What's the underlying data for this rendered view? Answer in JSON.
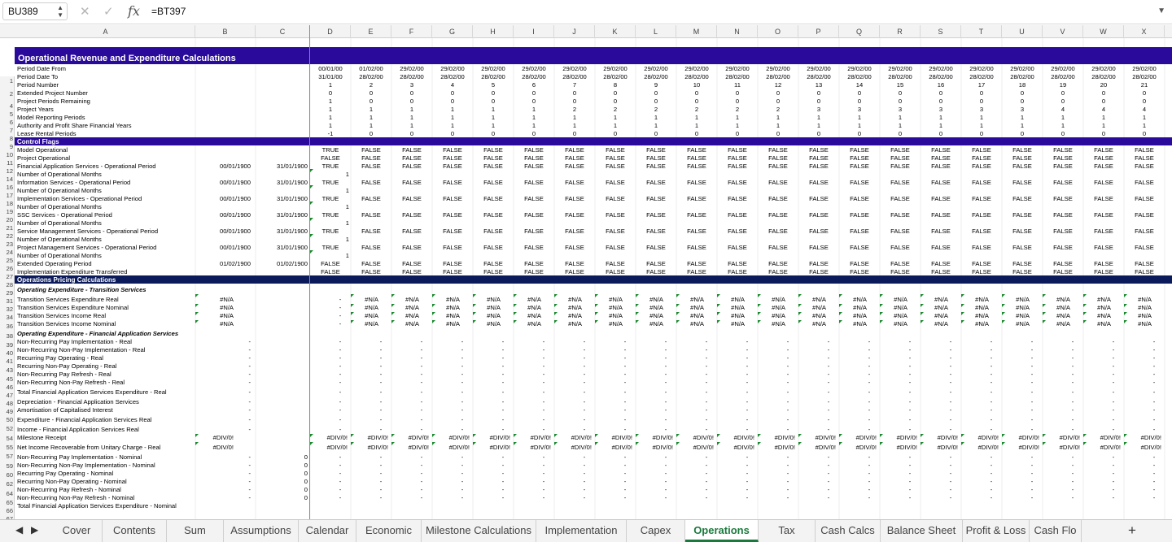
{
  "formula_bar": {
    "cell_ref": "BU389",
    "fx": "fx",
    "formula": "=BT397",
    "cancel_icon": "x-icon",
    "confirm_icon": "check-icon"
  },
  "columns": [
    "A",
    "B",
    "C",
    "D",
    "E",
    "F",
    "G",
    "H",
    "I",
    "J",
    "K",
    "L",
    "M",
    "N",
    "O",
    "P",
    "Q",
    "R",
    "S",
    "T",
    "U",
    "V",
    "W",
    "X"
  ],
  "sheet": {
    "title": "Operational Revenue and Expenditure Calculations",
    "rows": [
      {
        "n": "1"
      },
      {
        "n": "2",
        "a": "Operational Revenue and Expenditure Calculations",
        "kind": "title"
      },
      {
        "n": "4",
        "a": "Period Date From",
        "d": "00/01/00",
        "e": "01/02/00",
        "f": "29/02/00"
      },
      {
        "n": "5",
        "a": "Period Date To",
        "d": "31/01/00",
        "e": "28/02/00",
        "f": "28/02/00"
      },
      {
        "n": "6",
        "a": "Period Number",
        "seq": "1"
      },
      {
        "n": "7",
        "a": "Extended Project Number",
        "d": "0",
        "e": "0",
        "f": "0"
      },
      {
        "n": "8",
        "a": "Project Periods Remaining",
        "d": "1",
        "e": "0",
        "f": "0"
      },
      {
        "n": "9",
        "a": "Project Years",
        "d": "1",
        "e": "1",
        "f": "1",
        "steps": "1,1,1,1,1,1,2,2,2,2,2,2,3,3,3,3,3,3,4,4,4"
      },
      {
        "n": "10",
        "a": "Model Reporting Periods",
        "d": "1",
        "e": "1",
        "f": "1"
      },
      {
        "n": "11",
        "a": "Authority and Profit Share Financial Years",
        "d": "1",
        "e": "1",
        "f": "1"
      },
      {
        "n": "12",
        "a": "Lease Rental Periods",
        "d": "-1",
        "e": "0",
        "f": "0"
      },
      {
        "n": "14",
        "a": "Control Flags",
        "kind": "band"
      },
      {
        "n": "16",
        "a": "Model Operational",
        "d": "TRUE",
        "e": "FALSE",
        "f": "FALSE"
      },
      {
        "n": "17",
        "a": "Project Operational",
        "d": "FALSE",
        "e": "FALSE",
        "f": "FALSE"
      },
      {
        "n": "18",
        "a": "Financial Application Services - Operational Period",
        "b": "00/01/1900",
        "c": "31/01/1900",
        "d": "TRUE",
        "e": "FALSE",
        "f": "FALSE"
      },
      {
        "n": "19",
        "a": "Number of Operational Months",
        "dl": "1"
      },
      {
        "n": "20",
        "a": "Information Services - Operational Period",
        "b": "00/01/1900",
        "c": "31/01/1900",
        "d": "TRUE",
        "e": "FALSE",
        "f": "FALSE"
      },
      {
        "n": "21",
        "a": "Number of Operational Months",
        "dl": "1"
      },
      {
        "n": "22",
        "a": "Implementation Services - Operational Period",
        "b": "00/01/1900",
        "c": "31/01/1900",
        "d": "TRUE",
        "e": "FALSE",
        "f": "FALSE"
      },
      {
        "n": "23",
        "a": "Number of Operational Months",
        "dl": "1"
      },
      {
        "n": "24",
        "a": "SSC Services - Operational Period",
        "b": "00/01/1900",
        "c": "31/01/1900",
        "d": "TRUE",
        "e": "FALSE",
        "f": "FALSE"
      },
      {
        "n": "25",
        "a": "Number of Operational Months",
        "dl": "1"
      },
      {
        "n": "26",
        "a": "Service Management Services - Operational Period",
        "b": "00/01/1900",
        "c": "31/01/1900",
        "d": "TRUE",
        "e": "FALSE",
        "f": "FALSE"
      },
      {
        "n": "27",
        "a": "Number of Operational Months",
        "dl": "1"
      },
      {
        "n": "28",
        "a": "Project Management Services - Operational Period",
        "b": "00/01/1900",
        "c": "31/01/1900",
        "d": "TRUE",
        "e": "FALSE",
        "f": "FALSE"
      },
      {
        "n": "29",
        "a": "Number of Operational Months",
        "dl": "1"
      },
      {
        "n": "31",
        "a": "Extended Operating Period",
        "b": "01/02/1900",
        "c": "01/02/1900",
        "d": "FALSE",
        "e": "FALSE",
        "f": "FALSE"
      },
      {
        "n": "32",
        "a": "Implementation Expenditure Transferred",
        "d": "FALSE",
        "e": "FALSE",
        "f": "FALSE"
      },
      {
        "n": "34",
        "a": "Operations Pricing Calculations",
        "kind": "band2"
      },
      {
        "n": "36",
        "a": "Operating Expenditure - Transition Services",
        "kind": "section"
      },
      {
        "n": "38",
        "a": "Transition Services Expenditure Real",
        "b": "#N/A",
        "d": "-",
        "e": "#N/A",
        "f": "#N/A"
      },
      {
        "n": "39",
        "a": "Transition Services Expenditure Nominal",
        "b": "#N/A",
        "d": "-",
        "e": "#N/A",
        "f": "#N/A"
      },
      {
        "n": "40",
        "a": "Transition Services Income Real",
        "b": "#N/A",
        "d": "-",
        "e": "#N/A",
        "f": "#N/A"
      },
      {
        "n": "41",
        "a": "Transition Services Income Nominal",
        "b": "#N/A",
        "d": "-",
        "e": "#N/A",
        "f": "#N/A"
      },
      {
        "n": "43",
        "a": "Operating Expenditure - Financial Application Services",
        "kind": "section"
      },
      {
        "n": "45",
        "a": "Non-Recurring Pay Implementation - Real",
        "b": "-",
        "d": "-",
        "e": "-",
        "f": "-"
      },
      {
        "n": "46",
        "a": "Non-Recurring Non-Pay Implementation - Real",
        "b": "-",
        "d": "-",
        "e": "-",
        "f": "-"
      },
      {
        "n": "47",
        "a": "Recurring Pay Operating - Real",
        "b": "-",
        "d": "-",
        "e": "-",
        "f": "-"
      },
      {
        "n": "48",
        "a": "Recurring Non-Pay Operating - Real",
        "b": "-",
        "d": "-",
        "e": "-",
        "f": "-"
      },
      {
        "n": "49",
        "a": "Non-Recurring Pay Refresh - Real",
        "b": "-",
        "d": "-",
        "e": "-",
        "f": "-"
      },
      {
        "n": "50",
        "a": "Non-Recurring Non-Pay Refresh - Real",
        "b": "-",
        "d": "-",
        "e": "-",
        "f": "-"
      },
      {
        "n": "52",
        "a": "Total Financial Application Services Expenditure - Real",
        "b": "-",
        "d": "-",
        "e": "-",
        "f": "-"
      },
      {
        "n": "54",
        "a": "Depreciation - Financial Application Services",
        "b": "-",
        "d": "-",
        "e": "-",
        "f": "-"
      },
      {
        "n": "55",
        "a": "Amortisation of Capitalised Interest",
        "b": "-",
        "d": "-",
        "e": "-",
        "f": "-"
      },
      {
        "n": "57",
        "a": "Expenditure - Financial Application Services Real",
        "b": "-",
        "d": "-",
        "e": "-",
        "f": "-"
      },
      {
        "n": "59",
        "a": "Income - Financial Application Services Real",
        "b": "-",
        "d": "-",
        "e": "-",
        "f": "-"
      },
      {
        "n": "60",
        "a": "Milestone Receipt",
        "b": "#DIV/0!",
        "d": "#DIV/0!",
        "e": "#DIV/0!",
        "f": "#DIV/0!"
      },
      {
        "n": "62",
        "a": "Net Income Recoverable from Unitary Charge - Real",
        "b": "#DIV/0!",
        "d": "#DIV/0!",
        "e": "#DIV/0!",
        "f": "#DIV/0!"
      },
      {
        "n": "64",
        "a": "Non-Recurring Pay Implementation - Nominal",
        "b": "-",
        "c": "0",
        "d": "-",
        "e": "-",
        "f": "-"
      },
      {
        "n": "65",
        "a": "Non-Recurring Non-Pay Implementation - Nominal",
        "b": "-",
        "c": "0",
        "d": "-",
        "e": "-",
        "f": "-"
      },
      {
        "n": "66",
        "a": "Recurring Pay Operating - Nominal",
        "b": "-",
        "c": "0",
        "d": "-",
        "e": "-",
        "f": "-"
      },
      {
        "n": "67",
        "a": "Recurring Non-Pay Operating - Nominal",
        "b": "-",
        "c": "0",
        "d": "-",
        "e": "-",
        "f": "-"
      },
      {
        "n": "68",
        "a": "Non-Recurring Pay Refresh - Nominal",
        "b": "-",
        "c": "0",
        "d": "-",
        "e": "-",
        "f": "-"
      },
      {
        "n": "69",
        "a": "Non-Recurring Non-Pay Refresh - Nominal",
        "b": "-",
        "c": "0",
        "d": "-",
        "e": "-",
        "f": "-"
      },
      {
        "n": "71",
        "a": "Total Financial Application Services Expenditure - Nominal"
      }
    ]
  },
  "tabs": {
    "items": [
      "Cover",
      "Contents",
      "Sum",
      "Assumptions",
      "Calendar",
      "Economic",
      "Milestone Calculations",
      "Implementation",
      "Capex",
      "Operations",
      "Tax",
      "Cash Calcs",
      "Balance Sheet",
      "Profit & Loss",
      "Cash Flo"
    ],
    "active": "Operations",
    "add_label": "+"
  },
  "colors": {
    "header_band": "#2a0a9a",
    "band2": "#0a1a5a",
    "active_tab": "#1a7a3c",
    "marker": "#1a8a2e"
  }
}
